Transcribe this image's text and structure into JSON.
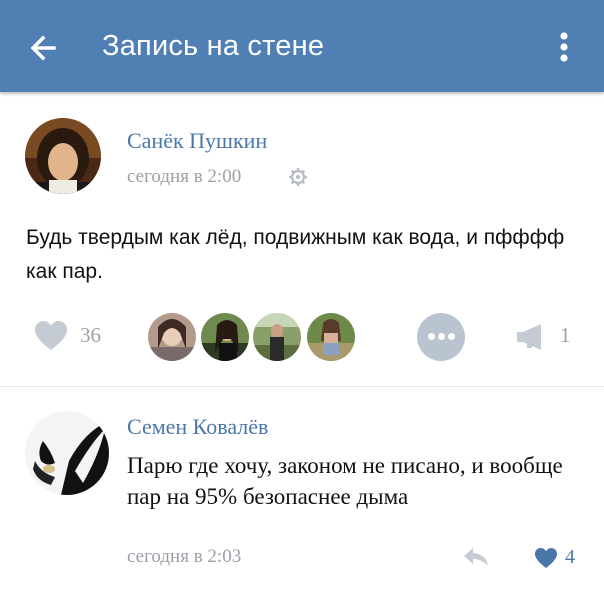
{
  "header": {
    "title": "Запись на стене",
    "back_icon": "arrow-left-icon",
    "menu_icon": "vertical-dots-icon"
  },
  "post": {
    "author": "Санёк Пушкин",
    "time": "сегодня в 2:00",
    "text": "Будь твердым как лёд, подвижным как вода, и пфффф как пар.",
    "likes": "36",
    "shares": "1"
  },
  "comment": {
    "author": "Семен Ковалёв",
    "text": "Парю где хочу, законом не писано, и вообще пар на 95% безопаснее дыма",
    "time": "сегодня в 2:03",
    "likes": "4"
  },
  "colors": {
    "header_bg": "#4f7fb3",
    "link_blue": "#4a77a8",
    "muted_gray": "#9aa0a6"
  }
}
